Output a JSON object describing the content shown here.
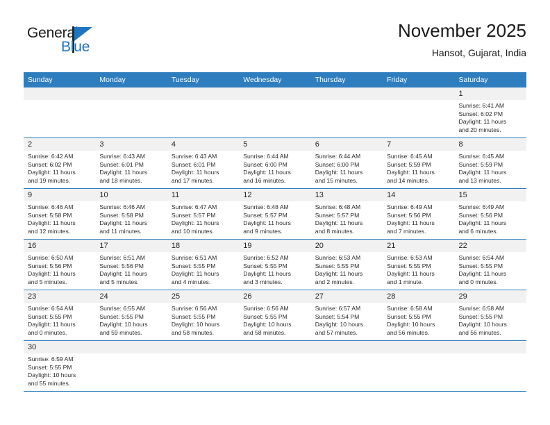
{
  "logo": {
    "text_primary": "General",
    "text_secondary": "Blue",
    "primary_color": "#1b1b1b",
    "secondary_color": "#1d76bf",
    "icon": "triangle-flag-icon"
  },
  "header": {
    "title": "November 2025",
    "subtitle": "Hansot, Gujarat, India"
  },
  "colors": {
    "header_blue": "#2e7dbf",
    "daynum_band": "#f1f1f1",
    "text": "#2b2b2b"
  },
  "weekday_headers": [
    "Sunday",
    "Monday",
    "Tuesday",
    "Wednesday",
    "Thursday",
    "Friday",
    "Saturday"
  ],
  "weeks": [
    [
      {
        "day": "",
        "empty": true
      },
      {
        "day": "",
        "empty": true
      },
      {
        "day": "",
        "empty": true
      },
      {
        "day": "",
        "empty": true
      },
      {
        "day": "",
        "empty": true
      },
      {
        "day": "",
        "empty": true
      },
      {
        "day": "1",
        "sunrise": "Sunrise: 6:41 AM",
        "sunset": "Sunset: 6:02 PM",
        "daylight_line1": "Daylight: 11 hours",
        "daylight_line2": "and 20 minutes."
      }
    ],
    [
      {
        "day": "2",
        "sunrise": "Sunrise: 6:42 AM",
        "sunset": "Sunset: 6:02 PM",
        "daylight_line1": "Daylight: 11 hours",
        "daylight_line2": "and 19 minutes."
      },
      {
        "day": "3",
        "sunrise": "Sunrise: 6:43 AM",
        "sunset": "Sunset: 6:01 PM",
        "daylight_line1": "Daylight: 11 hours",
        "daylight_line2": "and 18 minutes."
      },
      {
        "day": "4",
        "sunrise": "Sunrise: 6:43 AM",
        "sunset": "Sunset: 6:01 PM",
        "daylight_line1": "Daylight: 11 hours",
        "daylight_line2": "and 17 minutes."
      },
      {
        "day": "5",
        "sunrise": "Sunrise: 6:44 AM",
        "sunset": "Sunset: 6:00 PM",
        "daylight_line1": "Daylight: 11 hours",
        "daylight_line2": "and 16 minutes."
      },
      {
        "day": "6",
        "sunrise": "Sunrise: 6:44 AM",
        "sunset": "Sunset: 6:00 PM",
        "daylight_line1": "Daylight: 11 hours",
        "daylight_line2": "and 15 minutes."
      },
      {
        "day": "7",
        "sunrise": "Sunrise: 6:45 AM",
        "sunset": "Sunset: 5:59 PM",
        "daylight_line1": "Daylight: 11 hours",
        "daylight_line2": "and 14 minutes."
      },
      {
        "day": "8",
        "sunrise": "Sunrise: 6:45 AM",
        "sunset": "Sunset: 5:59 PM",
        "daylight_line1": "Daylight: 11 hours",
        "daylight_line2": "and 13 minutes."
      }
    ],
    [
      {
        "day": "9",
        "sunrise": "Sunrise: 6:46 AM",
        "sunset": "Sunset: 5:58 PM",
        "daylight_line1": "Daylight: 11 hours",
        "daylight_line2": "and 12 minutes."
      },
      {
        "day": "10",
        "sunrise": "Sunrise: 6:46 AM",
        "sunset": "Sunset: 5:58 PM",
        "daylight_line1": "Daylight: 11 hours",
        "daylight_line2": "and 11 minutes."
      },
      {
        "day": "11",
        "sunrise": "Sunrise: 6:47 AM",
        "sunset": "Sunset: 5:57 PM",
        "daylight_line1": "Daylight: 11 hours",
        "daylight_line2": "and 10 minutes."
      },
      {
        "day": "12",
        "sunrise": "Sunrise: 6:48 AM",
        "sunset": "Sunset: 5:57 PM",
        "daylight_line1": "Daylight: 11 hours",
        "daylight_line2": "and 9 minutes."
      },
      {
        "day": "13",
        "sunrise": "Sunrise: 6:48 AM",
        "sunset": "Sunset: 5:57 PM",
        "daylight_line1": "Daylight: 11 hours",
        "daylight_line2": "and 8 minutes."
      },
      {
        "day": "14",
        "sunrise": "Sunrise: 6:49 AM",
        "sunset": "Sunset: 5:56 PM",
        "daylight_line1": "Daylight: 11 hours",
        "daylight_line2": "and 7 minutes."
      },
      {
        "day": "15",
        "sunrise": "Sunrise: 6:49 AM",
        "sunset": "Sunset: 5:56 PM",
        "daylight_line1": "Daylight: 11 hours",
        "daylight_line2": "and 6 minutes."
      }
    ],
    [
      {
        "day": "16",
        "sunrise": "Sunrise: 6:50 AM",
        "sunset": "Sunset: 5:56 PM",
        "daylight_line1": "Daylight: 11 hours",
        "daylight_line2": "and 5 minutes."
      },
      {
        "day": "17",
        "sunrise": "Sunrise: 6:51 AM",
        "sunset": "Sunset: 5:56 PM",
        "daylight_line1": "Daylight: 11 hours",
        "daylight_line2": "and 5 minutes."
      },
      {
        "day": "18",
        "sunrise": "Sunrise: 6:51 AM",
        "sunset": "Sunset: 5:55 PM",
        "daylight_line1": "Daylight: 11 hours",
        "daylight_line2": "and 4 minutes."
      },
      {
        "day": "19",
        "sunrise": "Sunrise: 6:52 AM",
        "sunset": "Sunset: 5:55 PM",
        "daylight_line1": "Daylight: 11 hours",
        "daylight_line2": "and 3 minutes."
      },
      {
        "day": "20",
        "sunrise": "Sunrise: 6:53 AM",
        "sunset": "Sunset: 5:55 PM",
        "daylight_line1": "Daylight: 11 hours",
        "daylight_line2": "and 2 minutes."
      },
      {
        "day": "21",
        "sunrise": "Sunrise: 6:53 AM",
        "sunset": "Sunset: 5:55 PM",
        "daylight_line1": "Daylight: 11 hours",
        "daylight_line2": "and 1 minute."
      },
      {
        "day": "22",
        "sunrise": "Sunrise: 6:54 AM",
        "sunset": "Sunset: 5:55 PM",
        "daylight_line1": "Daylight: 11 hours",
        "daylight_line2": "and 0 minutes."
      }
    ],
    [
      {
        "day": "23",
        "sunrise": "Sunrise: 6:54 AM",
        "sunset": "Sunset: 5:55 PM",
        "daylight_line1": "Daylight: 11 hours",
        "daylight_line2": "and 0 minutes."
      },
      {
        "day": "24",
        "sunrise": "Sunrise: 6:55 AM",
        "sunset": "Sunset: 5:55 PM",
        "daylight_line1": "Daylight: 10 hours",
        "daylight_line2": "and 59 minutes."
      },
      {
        "day": "25",
        "sunrise": "Sunrise: 6:56 AM",
        "sunset": "Sunset: 5:55 PM",
        "daylight_line1": "Daylight: 10 hours",
        "daylight_line2": "and 58 minutes."
      },
      {
        "day": "26",
        "sunrise": "Sunrise: 6:56 AM",
        "sunset": "Sunset: 5:55 PM",
        "daylight_line1": "Daylight: 10 hours",
        "daylight_line2": "and 58 minutes."
      },
      {
        "day": "27",
        "sunrise": "Sunrise: 6:57 AM",
        "sunset": "Sunset: 5:54 PM",
        "daylight_line1": "Daylight: 10 hours",
        "daylight_line2": "and 57 minutes."
      },
      {
        "day": "28",
        "sunrise": "Sunrise: 6:58 AM",
        "sunset": "Sunset: 5:55 PM",
        "daylight_line1": "Daylight: 10 hours",
        "daylight_line2": "and 56 minutes."
      },
      {
        "day": "29",
        "sunrise": "Sunrise: 6:58 AM",
        "sunset": "Sunset: 5:55 PM",
        "daylight_line1": "Daylight: 10 hours",
        "daylight_line2": "and 56 minutes."
      }
    ],
    [
      {
        "day": "30",
        "sunrise": "Sunrise: 6:59 AM",
        "sunset": "Sunset: 5:55 PM",
        "daylight_line1": "Daylight: 10 hours",
        "daylight_line2": "and 55 minutes."
      },
      {
        "day": "",
        "empty": true
      },
      {
        "day": "",
        "empty": true
      },
      {
        "day": "",
        "empty": true
      },
      {
        "day": "",
        "empty": true
      },
      {
        "day": "",
        "empty": true
      },
      {
        "day": "",
        "empty": true
      }
    ]
  ]
}
